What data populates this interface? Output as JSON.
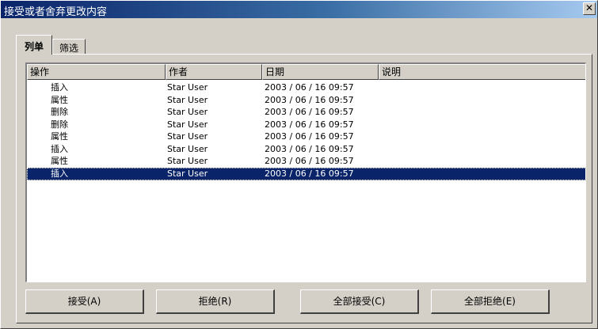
{
  "window": {
    "title": "接受或者舍弃更改内容",
    "close_label": "✕"
  },
  "tabs": [
    {
      "label": "列单",
      "active": true
    },
    {
      "label": "筛选",
      "active": false
    }
  ],
  "list": {
    "columns": [
      "操作",
      "作者",
      "日期",
      "说明"
    ],
    "rows": [
      {
        "action": "插入",
        "author": "Star User",
        "date": "2003 / 06 / 16 09:57",
        "comment": "",
        "selected": false
      },
      {
        "action": "属性",
        "author": "Star User",
        "date": "2003 / 06 / 16 09:57",
        "comment": "",
        "selected": false
      },
      {
        "action": "删除",
        "author": "Star User",
        "date": "2003 / 06 / 16 09:57",
        "comment": "",
        "selected": false
      },
      {
        "action": "删除",
        "author": "Star User",
        "date": "2003 / 06 / 16 09:57",
        "comment": "",
        "selected": false
      },
      {
        "action": "属性",
        "author": "Star User",
        "date": "2003 / 06 / 16 09:57",
        "comment": "",
        "selected": false
      },
      {
        "action": "插入",
        "author": "Star User",
        "date": "2003 / 06 / 16 09:57",
        "comment": "",
        "selected": false
      },
      {
        "action": "属性",
        "author": "Star User",
        "date": "2003 / 06 / 16 09:57",
        "comment": "",
        "selected": false
      },
      {
        "action": "插入",
        "author": "Star User",
        "date": "2003 / 06 / 16 09:57",
        "comment": "",
        "selected": true
      }
    ]
  },
  "buttons": {
    "accept": "接受(A)",
    "reject": "拒绝(R)",
    "accept_all": "全部接受(C)",
    "reject_all": "全部拒绝(E)"
  },
  "colors": {
    "title_bar": "#0a246a",
    "selection": "#0a246a",
    "face": "#d4d0c8"
  }
}
